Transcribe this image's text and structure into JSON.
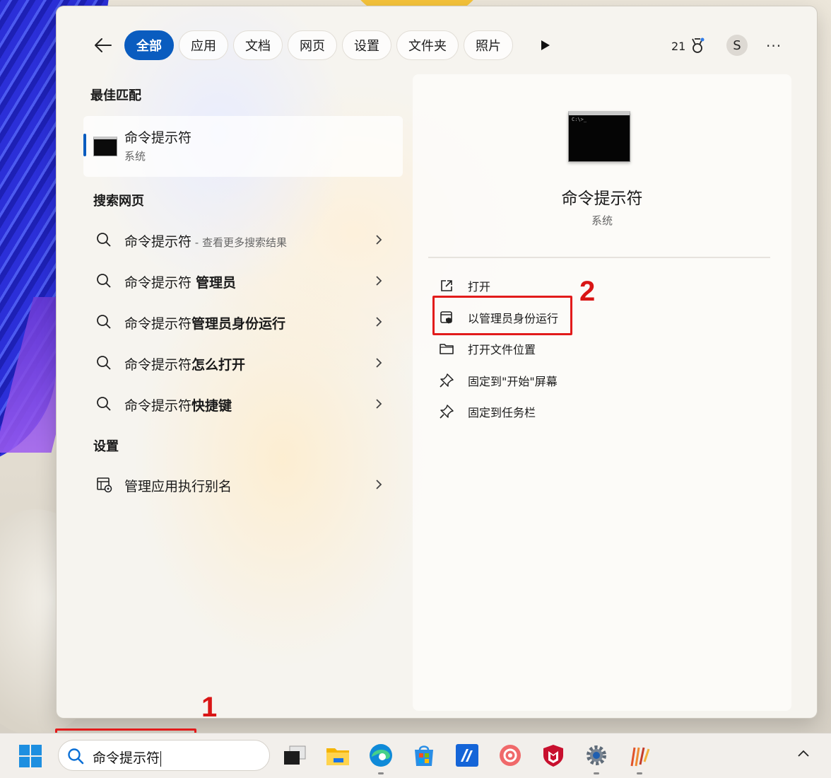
{
  "filters": [
    {
      "label": "全部",
      "active": true
    },
    {
      "label": "应用",
      "active": false
    },
    {
      "label": "文档",
      "active": false
    },
    {
      "label": "网页",
      "active": false
    },
    {
      "label": "设置",
      "active": false
    },
    {
      "label": "文件夹",
      "active": false
    },
    {
      "label": "照片",
      "active": false
    }
  ],
  "header": {
    "points": "21",
    "avatar_letter": "S",
    "more": "···"
  },
  "best_match": {
    "section_title": "最佳匹配",
    "name": "命令提示符",
    "type": "系统"
  },
  "web_search": {
    "section_title": "搜索网页",
    "items": [
      {
        "prefix": "命令提示符",
        "bold": "",
        "hint": " - 查看更多搜索结果"
      },
      {
        "prefix": "命令提示符 ",
        "bold": "管理员",
        "hint": ""
      },
      {
        "prefix": "命令提示符",
        "bold": "管理员身份运行",
        "hint": ""
      },
      {
        "prefix": "命令提示符",
        "bold": "怎么打开",
        "hint": ""
      },
      {
        "prefix": "命令提示符",
        "bold": "快捷键",
        "hint": ""
      }
    ]
  },
  "settings": {
    "section_title": "设置",
    "items": [
      {
        "label": "管理应用执行别名"
      }
    ]
  },
  "detail": {
    "title": "命令提示符",
    "subtitle": "系统",
    "icon_text": "C:\\>_",
    "actions": [
      {
        "label": "打开",
        "icon": "open-external-icon"
      },
      {
        "label": "以管理员身份运行",
        "icon": "admin-shield-icon"
      },
      {
        "label": "打开文件位置",
        "icon": "folder-icon"
      },
      {
        "label": "固定到\"开始\"屏幕",
        "icon": "pin-icon"
      },
      {
        "label": "固定到任务栏",
        "icon": "pin-icon"
      }
    ]
  },
  "annotations": {
    "step1": "1",
    "step2": "2"
  },
  "taskbar": {
    "search_value": "命令提示符",
    "apps": [
      "task-view",
      "file-explorer",
      "edge",
      "microsoft-store",
      "azure-app",
      "rec-app",
      "mcafee",
      "settings",
      "pencil-app"
    ]
  },
  "colors": {
    "accent": "#0a5cbf",
    "annotation_red": "#e21b1b"
  }
}
